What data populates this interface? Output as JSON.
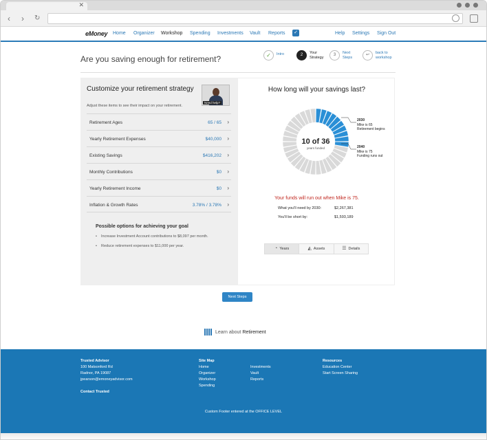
{
  "app": {
    "logo": "eMoney",
    "nav": [
      {
        "label": "Home"
      },
      {
        "label": "Organizer"
      },
      {
        "label": "Workshop"
      },
      {
        "label": "Spending"
      },
      {
        "label": "Investments"
      },
      {
        "label": "Vault"
      },
      {
        "label": "Reports"
      }
    ],
    "nav_right": [
      {
        "label": "Help"
      },
      {
        "label": "Settings"
      },
      {
        "label": "Sign Out"
      }
    ],
    "accent": "#2b78b5"
  },
  "header": {
    "title": "Are you saving enough for retirement?",
    "steps": [
      {
        "num": "✓",
        "label": "Intro"
      },
      {
        "num": "2",
        "label": "Your Strategy"
      },
      {
        "num": "3",
        "label": "Next Steps"
      },
      {
        "num": "↩",
        "label": "back to workshop"
      }
    ]
  },
  "left": {
    "title": "Customize your retirement strategy",
    "subtitle": "Adjust these items to see their impact on your retirement.",
    "video_label": "Need help?",
    "rows": [
      {
        "label": "Retirement Ages",
        "value": "65  / 65"
      },
      {
        "label": "Yearly Retirement Expenses",
        "value": "$40,000"
      },
      {
        "label": "Existing Savings",
        "value": "$416,202"
      },
      {
        "label": "Monthly Contributions",
        "value": "$0"
      },
      {
        "label": "Yearly Retirement Income",
        "value": "$0"
      },
      {
        "label": "Inflation & Growth Rates",
        "value": "3.78% / 3.78%"
      }
    ],
    "options_title": "Possible options for achieving your goal",
    "options": [
      "Increase Investment Account contributions to $8,097 per month.",
      "Reduce retirement expenses to $11,000 per year."
    ]
  },
  "right": {
    "title": "How long will your savings last?",
    "funded": 10,
    "total": 36,
    "center_big": "10 of 36",
    "center_small": "years funded",
    "callout1": {
      "year": "2030",
      "line1": "Mike is 65",
      "line2": "Retirement begins"
    },
    "callout2": {
      "year": "2040",
      "line1": "Mike is 75",
      "line2": "Funding runs out"
    },
    "runout_text": "Your funds will run out when Mike is 75.",
    "need_label": "What you'll need by 2030:",
    "need_value": "$2,267,381",
    "short_label": "You'll be short by:",
    "short_value": "$1,593,189",
    "tabs": [
      {
        "label": "Years",
        "icon": "spinner-icon"
      },
      {
        "label": "Assets",
        "icon": "chart-icon"
      },
      {
        "label": "Details",
        "icon": "list-icon"
      }
    ],
    "funded_color": "#2a8fd6",
    "unfunded_color": "#d9d9d9"
  },
  "next_button": "Next Steps",
  "learn": {
    "prefix": "Learn about ",
    "topic": "Retirement"
  },
  "footer": {
    "advisor": {
      "title": "Trusted Advisor",
      "lines": [
        "100 Matsonford Rd",
        "Radnor, PA 19087",
        "jpearson@emoneyadvisor.com"
      ],
      "contact": "Contact Trusted"
    },
    "sitemap": {
      "title": "Site Map",
      "col1": [
        "Home",
        "Organizer",
        "Workshop",
        "Spending"
      ],
      "col2": [
        "Investments",
        "Vault",
        "Reports"
      ]
    },
    "resources": {
      "title": "Resources",
      "links": [
        "Education Center",
        "Start Screen Sharing"
      ]
    },
    "custom": "Custom Footer entered at the OFFICE LEVEL"
  }
}
